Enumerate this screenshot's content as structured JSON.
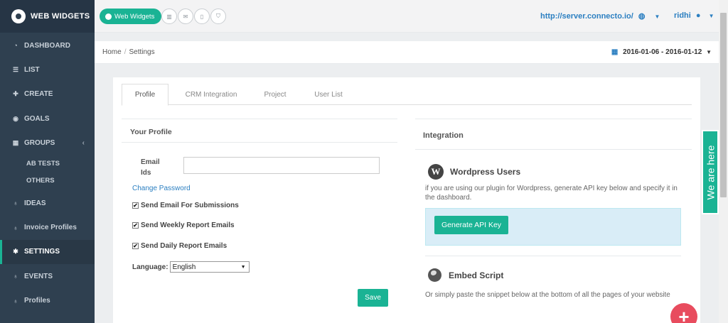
{
  "brand": {
    "name": "WEB WIDGETS"
  },
  "sidebar": {
    "items": [
      {
        "label": "DASHBOARD",
        "icon": "dashboard-icon"
      },
      {
        "label": "LIST",
        "icon": "list-icon"
      },
      {
        "label": "CREATE",
        "icon": "plus-icon"
      },
      {
        "label": "GOALS",
        "icon": "target-icon"
      },
      {
        "label": "GROUPS",
        "icon": "grid-icon"
      },
      {
        "label": "IDEAS",
        "icon": "bulb-icon"
      },
      {
        "label": "Invoice Profiles",
        "icon": "bulb-icon"
      },
      {
        "label": "SETTINGS",
        "icon": "gear-icon"
      },
      {
        "label": "EVENTS",
        "icon": "bulb-icon"
      },
      {
        "label": "Profiles",
        "icon": "bulb-icon"
      }
    ],
    "subitems": [
      "AB TESTS",
      "OTHERS"
    ],
    "active": "SETTINGS"
  },
  "topbar": {
    "widget_button": "Web Widgets",
    "url": "http://server.connecto.io/",
    "user": "ridhi"
  },
  "breadcrumb": {
    "home": "Home",
    "sep": "/",
    "current": "Settings"
  },
  "daterange": "2016-01-06 - 2016-01-12",
  "tabs": [
    "Profile",
    "CRM Integration",
    "Project",
    "User List"
  ],
  "profile": {
    "heading": "Your Profile",
    "email_label": "Email Ids",
    "email_value": "",
    "change_password": "Change Password",
    "checkboxes": [
      {
        "label": "Send Email For Submissions",
        "checked": true
      },
      {
        "label": "Send Weekly Report Emails",
        "checked": true
      },
      {
        "label": "Send Daily Report Emails",
        "checked": true
      }
    ],
    "language_label": "Language:",
    "language_value": "English",
    "save": "Save"
  },
  "integration": {
    "heading": "Integration",
    "wordpress_title": "Wordpress Users",
    "wordpress_text": "if you are using our plugin for Wordpress, generate API key below and specify it in the dashboard.",
    "generate_button": "Generate API Key",
    "embed_title": "Embed Script",
    "embed_text": "Or simply paste the snippet below at the bottom of all the pages of your website"
  },
  "floating": {
    "we_are_here": "We are here",
    "fab": "+"
  },
  "colors": {
    "accent": "#1ab394",
    "sidebar": "#2f4050",
    "link": "#2b7fc1",
    "fab": "#e84c5e"
  }
}
